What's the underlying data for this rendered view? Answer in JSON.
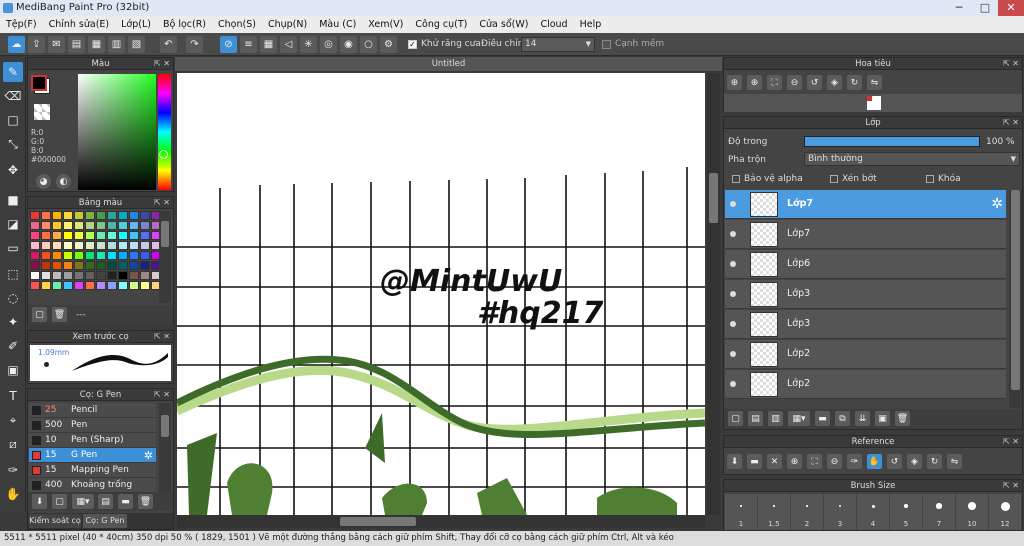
{
  "window": {
    "title": "MediBang Paint Pro (32bit)"
  },
  "menu": [
    "Tệp(F)",
    "Chỉnh sửa(E)",
    "Lớp(L)",
    "Bộ lọc(R)",
    "Chọn(S)",
    "Chụp(N)",
    "Màu (C)",
    "Xem(V)",
    "Công cụ(T)",
    "Cửa sổ(W)",
    "Cloud",
    "Help"
  ],
  "toolbar": {
    "antialias_label": "Khử răng cưa",
    "adjust_label": "Điều chỉnh",
    "adjust_value": "14",
    "snap_label": "Cạnh mềm"
  },
  "color_panel": {
    "title": "Màu",
    "r": "R:0",
    "g": "G:0",
    "b": "B:0",
    "hex": "#000000",
    "primary": "#000000",
    "secondary": "#ffffff"
  },
  "palette_panel": {
    "title": "Bảng màu",
    "footer": "---"
  },
  "preview_panel": {
    "title": "Xem trước cọ",
    "size": "1.09mm"
  },
  "brush_panel": {
    "title": "Cọ: G Pen",
    "items": [
      {
        "size": "25",
        "name": "Pencil",
        "color": "#222222",
        "sizecolor": "#ff8a65"
      },
      {
        "size": "500",
        "name": "Pen",
        "color": "#222222",
        "sizecolor": "#eeeeee"
      },
      {
        "size": "10",
        "name": "Pen (Sharp)",
        "color": "#222222",
        "sizecolor": "#eeeeee"
      },
      {
        "size": "15",
        "name": "G Pen",
        "color": "#e53935",
        "sizecolor": "#ffffff"
      },
      {
        "size": "15",
        "name": "Mapping Pen",
        "color": "#e53935",
        "sizecolor": "#eeeeee"
      },
      {
        "size": "400",
        "name": "Khoảng trống [Edge",
        "color": "#222222",
        "sizecolor": "#eeeeee"
      }
    ],
    "tabs": [
      "Kiểm soát cọ",
      "Cọ: G Pen"
    ]
  },
  "canvas": {
    "tab": "Untitled",
    "watermark_line1": "@MintUwU",
    "watermark_line2": "#hq217"
  },
  "navigator_panel": {
    "title": "Hoa tiêu"
  },
  "layer_panel": {
    "title": "Lớp",
    "opacity_label": "Độ trong",
    "opacity_value": "100 %",
    "opacity": 1.0,
    "blend_label": "Pha trộn",
    "blend_value": "Bình thường",
    "protect_alpha": "Bảo vệ alpha",
    "clip": "Xén bớt",
    "lock": "Khóa",
    "layers": [
      "Lớp7",
      "Lớp7",
      "Lớp6",
      "Lớp3",
      "Lớp3",
      "Lớp2",
      "Lớp2"
    ]
  },
  "reference_panel": {
    "title": "Reference"
  },
  "brushsize_panel": {
    "title": "Brush Size",
    "sizes": [
      "1",
      "1.5",
      "2",
      "3",
      "4",
      "5",
      "7",
      "10",
      "12"
    ]
  },
  "status": {
    "text": "5511 * 5511 pixel  (40 * 40cm)  350 dpi  50 %  ( 1829, 1501 )  Vẽ một đường thẳng bằng cách giữ phím Shift, Thay đổi cỡ cọ bằng cách giữ phím Ctrl, Alt và kéo"
  }
}
